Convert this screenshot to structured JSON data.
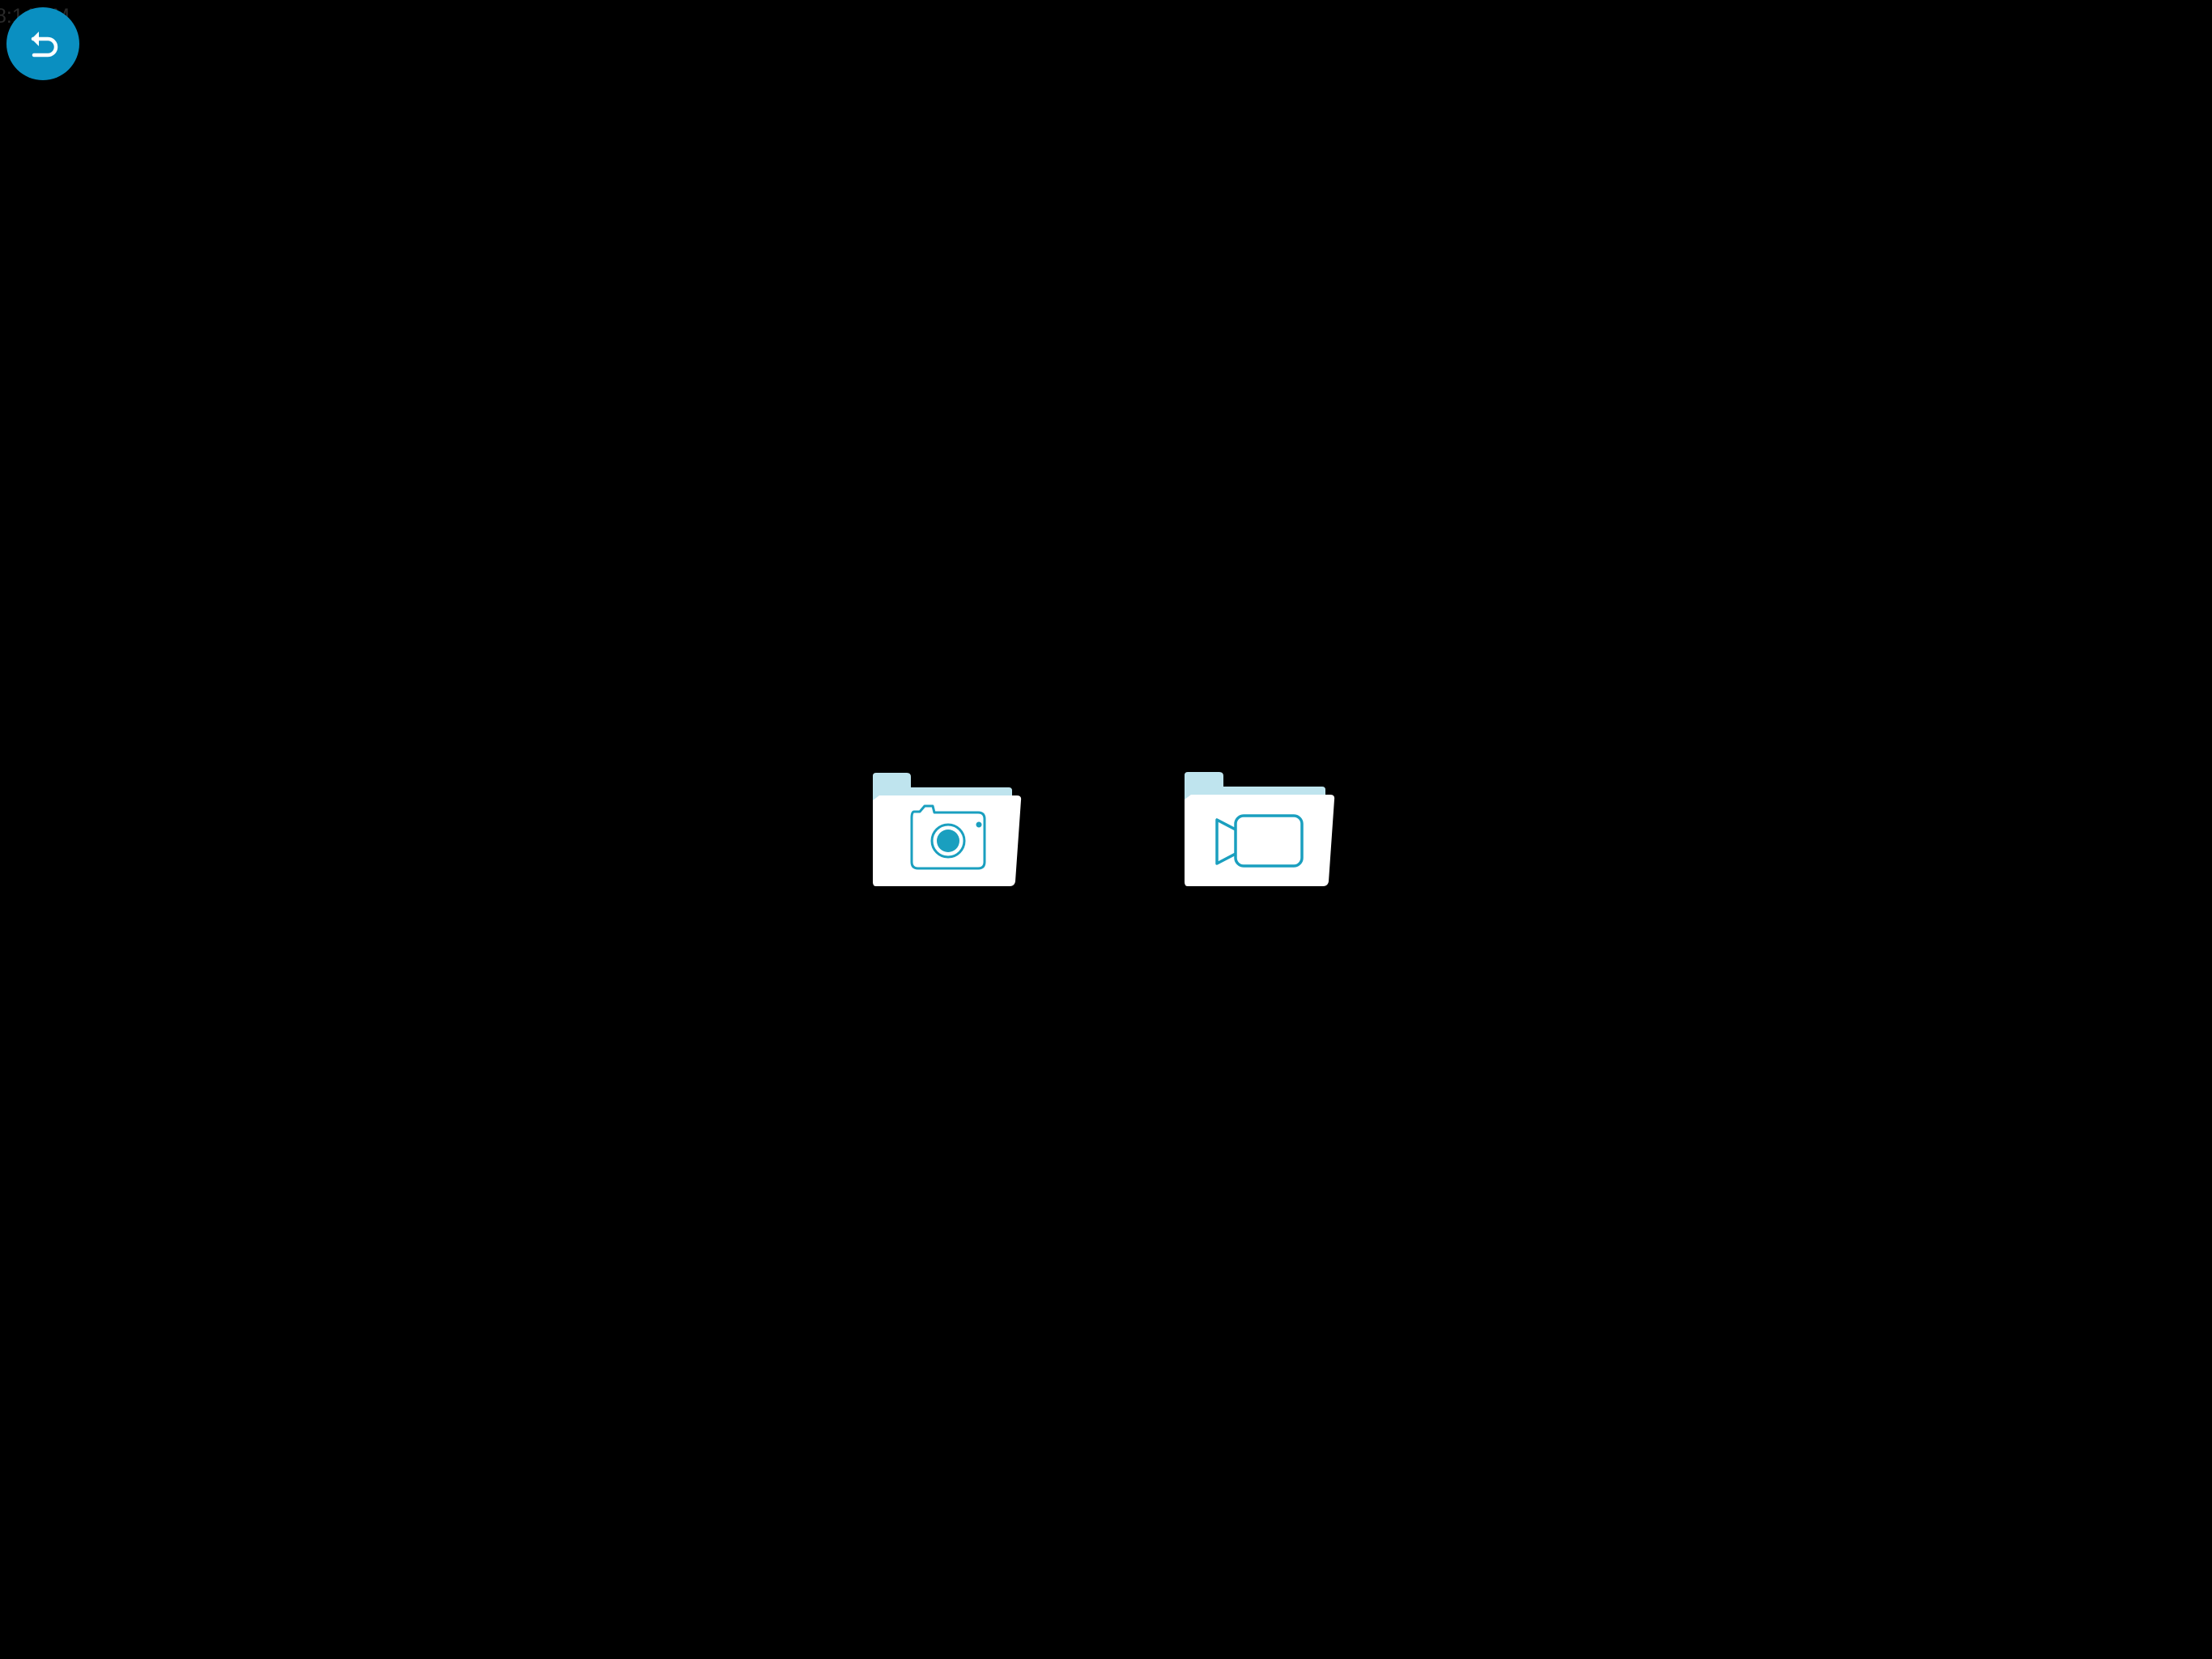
{
  "status_bar": {
    "time": "8:14 AM"
  },
  "back_button": {
    "icon": "return-arrow-icon"
  },
  "folders": [
    {
      "icon": "photo-folder-icon",
      "inner_icon": "camera-icon"
    },
    {
      "icon": "video-folder-icon",
      "inner_icon": "video-camera-icon"
    }
  ],
  "colors": {
    "background": "#000000",
    "accent": "#0a8fc1",
    "icon_line": "#1a9fbf",
    "folder_back": "#bfe4ee",
    "folder_front": "#ffffff"
  }
}
